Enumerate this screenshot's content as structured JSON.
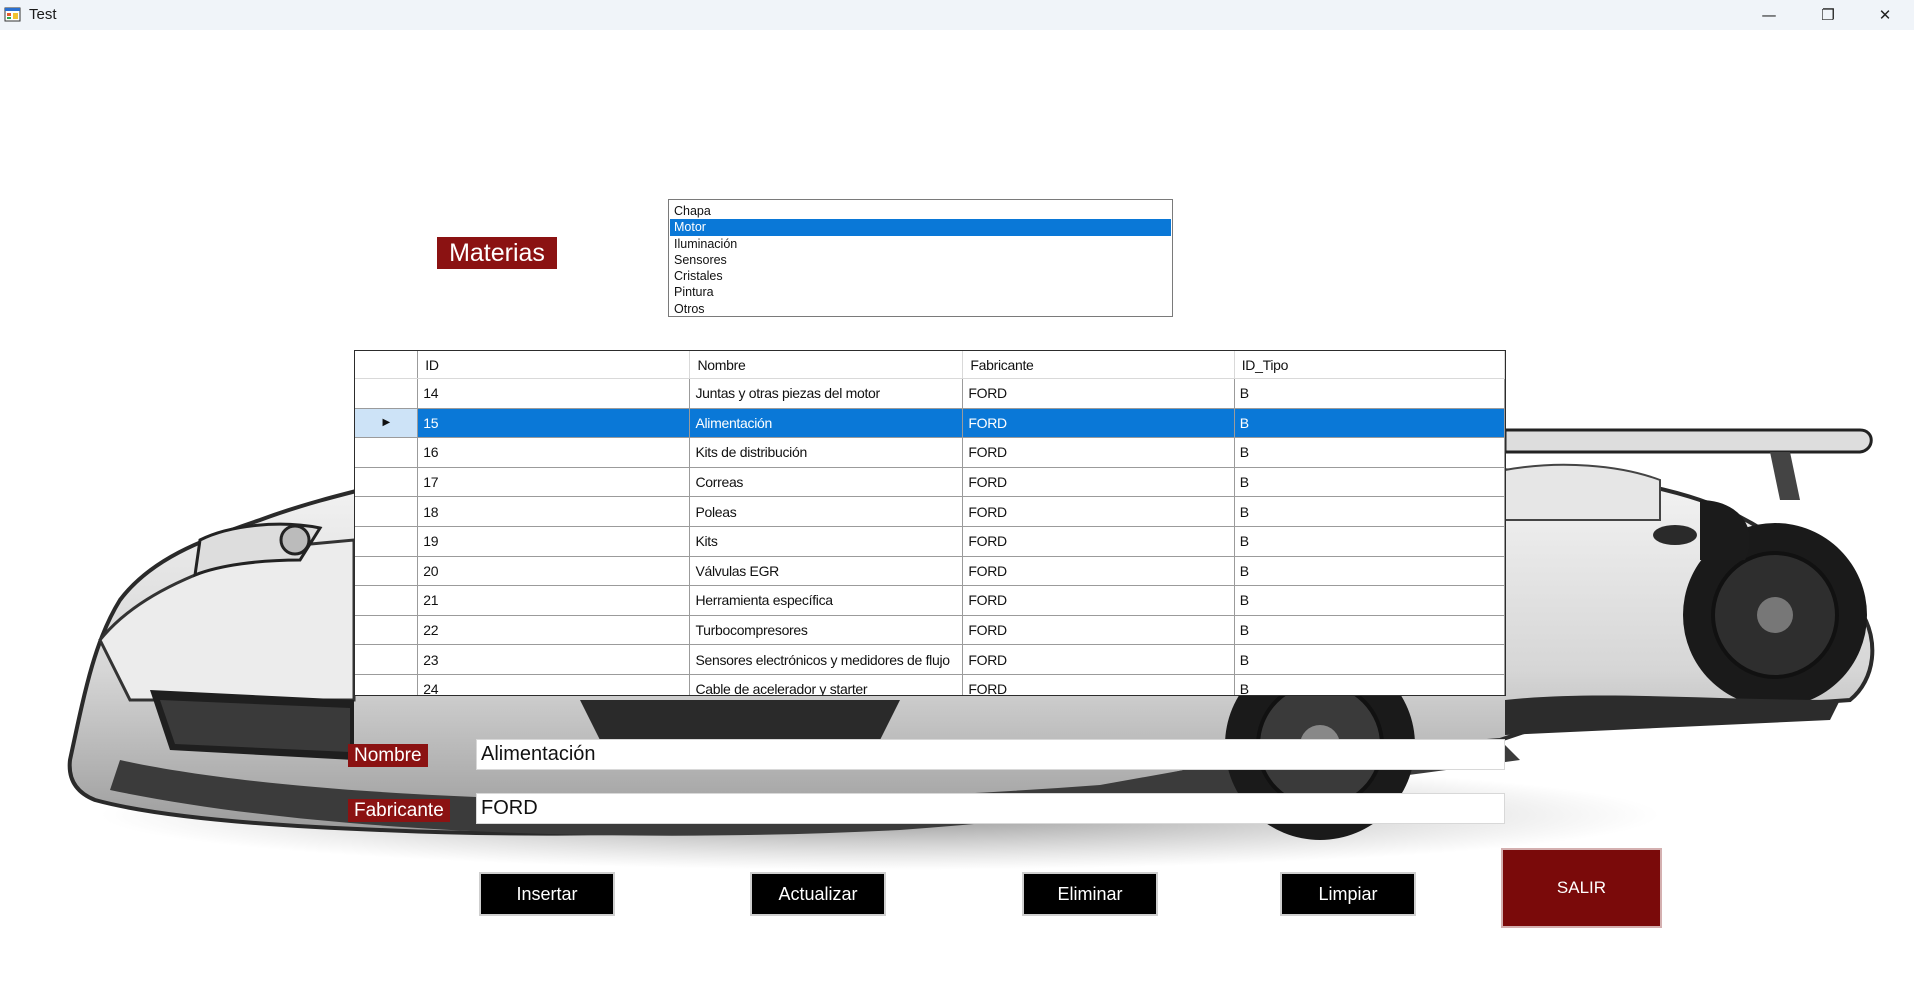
{
  "window": {
    "title": "Test",
    "minimize_glyph": "—",
    "maximize_glyph": "❐",
    "close_glyph": "✕"
  },
  "materias_label": "Materias",
  "categories": {
    "items": [
      "Chapa",
      "Motor",
      "Iluminación",
      "Sensores",
      "Cristales",
      "Pintura",
      "Otros"
    ],
    "selected": "Motor"
  },
  "grid": {
    "columns": [
      "ID",
      "Nombre",
      "Fabricante",
      "ID_Tipo"
    ],
    "selected_id": "15",
    "row_arrow": "▶",
    "rows": [
      {
        "id": "14",
        "nombre": "Juntas y otras piezas del motor",
        "fabricante": "FORD",
        "tipo": "B"
      },
      {
        "id": "15",
        "nombre": "Alimentación",
        "fabricante": "FORD",
        "tipo": "B"
      },
      {
        "id": "16",
        "nombre": "Kits de distribución",
        "fabricante": "FORD",
        "tipo": "B"
      },
      {
        "id": "17",
        "nombre": "Correas",
        "fabricante": "FORD",
        "tipo": "B"
      },
      {
        "id": "18",
        "nombre": "Poleas",
        "fabricante": "FORD",
        "tipo": "B"
      },
      {
        "id": "19",
        "nombre": "Kits",
        "fabricante": "FORD",
        "tipo": "B"
      },
      {
        "id": "20",
        "nombre": "Válvulas EGR",
        "fabricante": "FORD",
        "tipo": "B"
      },
      {
        "id": "21",
        "nombre": "Herramienta específica",
        "fabricante": "FORD",
        "tipo": "B"
      },
      {
        "id": "22",
        "nombre": "Turbocompresores",
        "fabricante": "FORD",
        "tipo": "B"
      },
      {
        "id": "23",
        "nombre": "Sensores electrónicos y medidores de flujo",
        "fabricante": "FORD",
        "tipo": "B"
      },
      {
        "id": "24",
        "nombre": "Cable de acelerador y starter",
        "fabricante": "FORD",
        "tipo": "B"
      }
    ]
  },
  "form": {
    "nombre_label": "Nombre",
    "nombre_value": "Alimentación",
    "fabricante_label": "Fabricante",
    "fabricante_value": "FORD"
  },
  "buttons": {
    "insertar": "Insertar",
    "actualizar": "Actualizar",
    "eliminar": "Eliminar",
    "limpiar": "Limpiar",
    "salir": "SALIR"
  },
  "colors": {
    "label_red": "#8b1212",
    "selection_blue": "#0a78d7",
    "salir_red": "#7a0a0a"
  }
}
